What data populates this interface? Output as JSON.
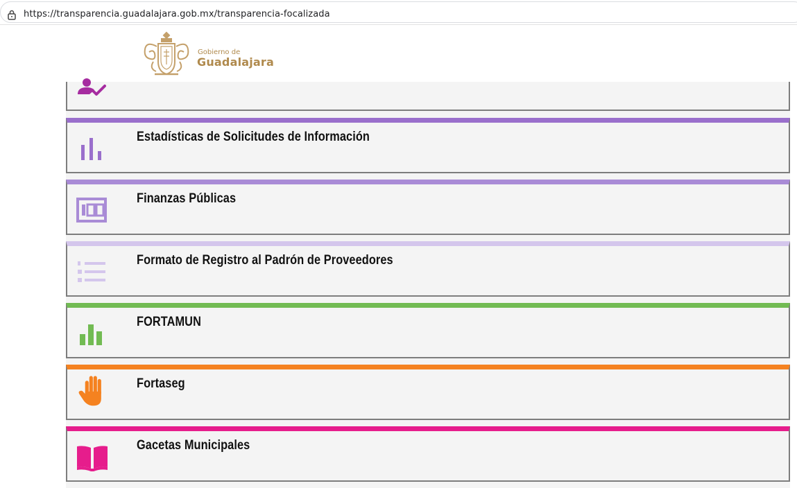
{
  "browser": {
    "url": "https://transparencia.guadalajara.gob.mx/transparencia-focalizada",
    "icons": {
      "lock": "lock-icon"
    }
  },
  "header": {
    "logo_line1": "Gobierno de",
    "logo_line2": "Guadalajara",
    "logo_color": "#b08a4d",
    "crest_icon": "coat-of-arms-icon"
  },
  "cards": [
    {
      "title": "",
      "icon": "user-check-icon",
      "accent": "#a62ca0"
    },
    {
      "title": "Estadísticas de Solicitudes de Información",
      "icon": "bar-chart-icon",
      "accent": "#9a6fcc"
    },
    {
      "title": "Finanzas Públicas",
      "icon": "hundred-box-icon",
      "accent": "#a98bd6"
    },
    {
      "title": "Formato de Registro al Padrón de Proveedores",
      "icon": "numbered-list-icon",
      "accent": "#d4c6ec"
    },
    {
      "title": "FORTAMUN",
      "icon": "bar-chart-icon",
      "accent": "#72bb53"
    },
    {
      "title": "Fortaseg",
      "icon": "hand-icon",
      "accent": "#f58220"
    },
    {
      "title": "Gacetas Municipales",
      "icon": "open-book-icon",
      "accent": "#e61d8c"
    }
  ]
}
